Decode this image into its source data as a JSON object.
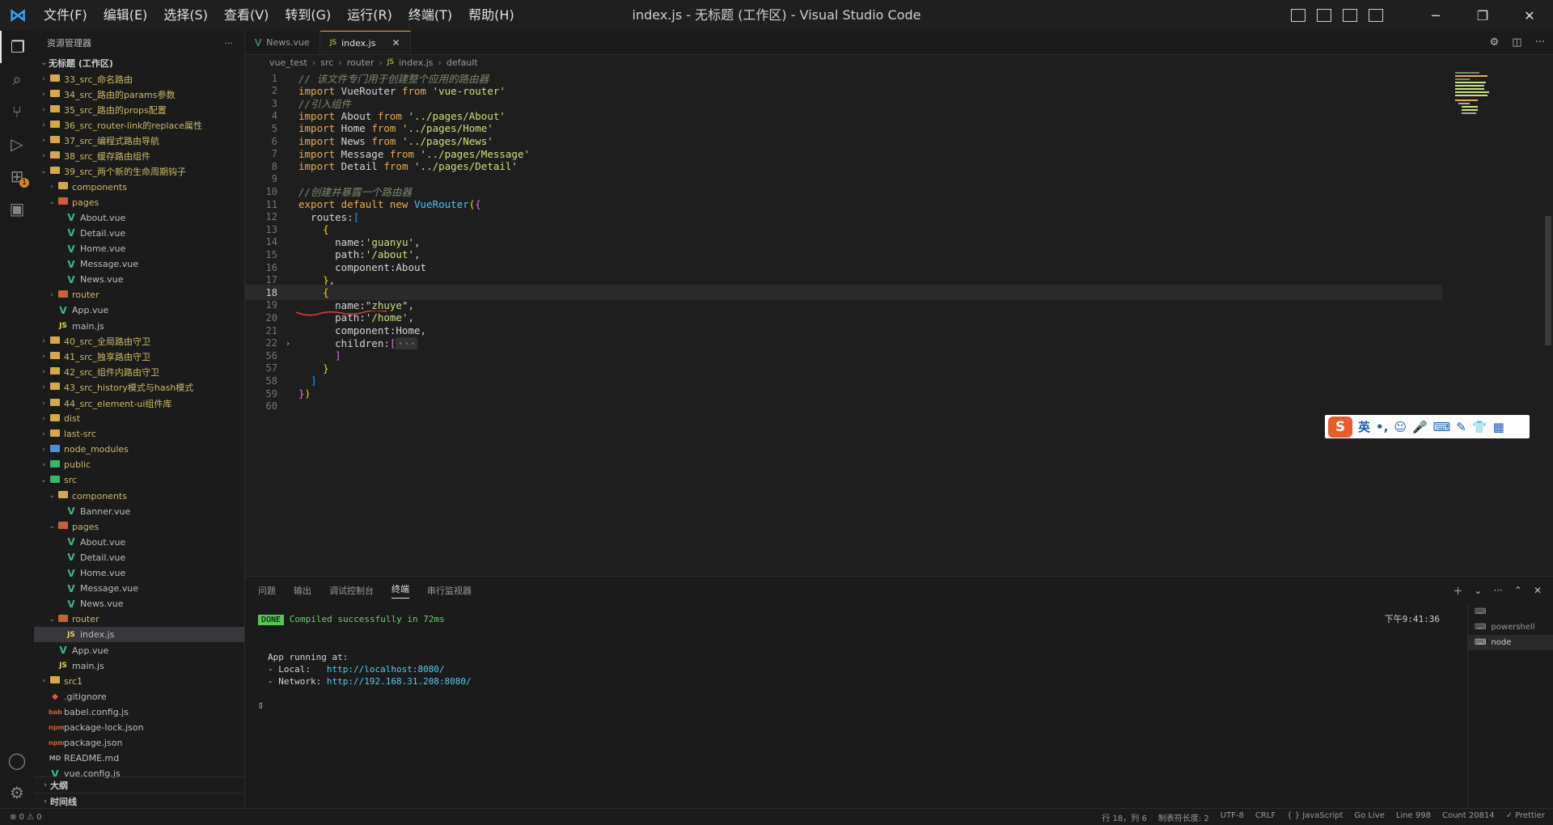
{
  "window": {
    "title": "index.js - 无标题 (工作区) - Visual Studio Code",
    "menu": [
      "文件(F)",
      "编辑(E)",
      "选择(S)",
      "查看(V)",
      "转到(G)",
      "运行(R)",
      "终端(T)",
      "帮助(H)"
    ]
  },
  "sidebar": {
    "header": "资源管理器",
    "more": "···",
    "workspace": "无标题 (工作区)",
    "tree": [
      {
        "label": "33_src_命名路由",
        "type": "folder",
        "depth": 1,
        "open": false,
        "color": "yellow"
      },
      {
        "label": "34_src_路由的params参数",
        "type": "folder",
        "depth": 1,
        "open": false,
        "color": "yellow"
      },
      {
        "label": "35_src_路由的props配置",
        "type": "folder",
        "depth": 1,
        "open": false,
        "color": "yellow"
      },
      {
        "label": "36_src_router-link的replace属性",
        "type": "folder",
        "depth": 1,
        "open": false,
        "color": "yellow"
      },
      {
        "label": "37_src_编程式路由导航",
        "type": "folder",
        "depth": 1,
        "open": false,
        "color": "yellow"
      },
      {
        "label": "38_src_缓存路由组件",
        "type": "folder",
        "depth": 1,
        "open": false,
        "color": "yellow"
      },
      {
        "label": "39_src_两个新的生命周期钩子",
        "type": "folder",
        "depth": 1,
        "open": true,
        "color": "yellow"
      },
      {
        "label": "components",
        "type": "folder",
        "depth": 2,
        "open": false,
        "color": "yellow"
      },
      {
        "label": "pages",
        "type": "folder",
        "depth": 2,
        "open": true,
        "color": "red"
      },
      {
        "label": "About.vue",
        "type": "vue",
        "depth": 3
      },
      {
        "label": "Detail.vue",
        "type": "vue",
        "depth": 3
      },
      {
        "label": "Home.vue",
        "type": "vue",
        "depth": 3
      },
      {
        "label": "Message.vue",
        "type": "vue",
        "depth": 3
      },
      {
        "label": "News.vue",
        "type": "vue",
        "depth": 3
      },
      {
        "label": "router",
        "type": "folder",
        "depth": 2,
        "open": false,
        "color": "red"
      },
      {
        "label": "App.vue",
        "type": "vue",
        "depth": 2
      },
      {
        "label": "main.js",
        "type": "js",
        "depth": 2
      },
      {
        "label": "40_src_全局路由守卫",
        "type": "folder",
        "depth": 1,
        "open": false,
        "color": "yellow"
      },
      {
        "label": "41_src_独享路由守卫",
        "type": "folder",
        "depth": 1,
        "open": false,
        "color": "yellow"
      },
      {
        "label": "42_src_组件内路由守卫",
        "type": "folder",
        "depth": 1,
        "open": false,
        "color": "yellow"
      },
      {
        "label": "43_src_history模式与hash模式",
        "type": "folder",
        "depth": 1,
        "open": false,
        "color": "yellow"
      },
      {
        "label": "44_src_element-ui组件库",
        "type": "folder",
        "depth": 1,
        "open": false,
        "color": "yellow"
      },
      {
        "label": "dist",
        "type": "folder",
        "depth": 1,
        "open": false,
        "color": "yellow"
      },
      {
        "label": "last-src",
        "type": "folder",
        "depth": 1,
        "open": false,
        "color": "yellow"
      },
      {
        "label": "node_modules",
        "type": "folder",
        "depth": 1,
        "open": false,
        "color": "blue"
      },
      {
        "label": "public",
        "type": "folder",
        "depth": 1,
        "open": false,
        "color": "green"
      },
      {
        "label": "src",
        "type": "folder",
        "depth": 1,
        "open": true,
        "color": "green"
      },
      {
        "label": "components",
        "type": "folder",
        "depth": 2,
        "open": true,
        "color": "yellow"
      },
      {
        "label": "Banner.vue",
        "type": "vue",
        "depth": 3
      },
      {
        "label": "pages",
        "type": "folder",
        "depth": 2,
        "open": true,
        "color": "red"
      },
      {
        "label": "About.vue",
        "type": "vue",
        "depth": 3
      },
      {
        "label": "Detail.vue",
        "type": "vue",
        "depth": 3
      },
      {
        "label": "Home.vue",
        "type": "vue",
        "depth": 3
      },
      {
        "label": "Message.vue",
        "type": "vue",
        "depth": 3
      },
      {
        "label": "News.vue",
        "type": "vue",
        "depth": 3
      },
      {
        "label": "router",
        "type": "folder",
        "depth": 2,
        "open": true,
        "color": "red"
      },
      {
        "label": "index.js",
        "type": "js",
        "depth": 3,
        "active": true
      },
      {
        "label": "App.vue",
        "type": "vue",
        "depth": 2
      },
      {
        "label": "main.js",
        "type": "js",
        "depth": 2
      },
      {
        "label": "src1",
        "type": "folder",
        "depth": 1,
        "open": false,
        "color": "yellow"
      },
      {
        "label": ".gitignore",
        "type": "git",
        "depth": 1
      },
      {
        "label": "babel.config.js",
        "type": "babel",
        "depth": 1
      },
      {
        "label": "package-lock.json",
        "type": "json",
        "depth": 1
      },
      {
        "label": "package.json",
        "type": "json",
        "depth": 1
      },
      {
        "label": "README.md",
        "type": "md",
        "depth": 1
      },
      {
        "label": "vue.config.js",
        "type": "vue",
        "depth": 1
      }
    ],
    "outline": "大纲",
    "timeline": "时间线"
  },
  "tabs": [
    {
      "label": "News.vue",
      "icon": "vue",
      "active": false
    },
    {
      "label": "index.js",
      "icon": "js",
      "active": true
    }
  ],
  "breadcrumbs": [
    "vue_test",
    "src",
    "router",
    "index.js",
    "default"
  ],
  "editor": {
    "lines": [
      {
        "n": "1",
        "html": "<span class='c-cm'>// 该文件专门用于创建整个应用的路由器</span>"
      },
      {
        "n": "2",
        "html": "<span class='c-kw'>import</span> VueRouter <span class='c-kw'>from</span> <span class='c-str'>'vue-router'</span>"
      },
      {
        "n": "3",
        "html": "<span class='c-cm'>//引入组件</span>"
      },
      {
        "n": "4",
        "html": "<span class='c-kw'>import</span> About <span class='c-kw'>from</span> <span class='c-str'>'../pages/About'</span>"
      },
      {
        "n": "5",
        "html": "<span class='c-kw'>import</span> Home <span class='c-kw'>from</span> <span class='c-str'>'../pages/Home'</span>"
      },
      {
        "n": "6",
        "html": "<span class='c-kw'>import</span> News <span class='c-kw'>from</span> <span class='c-str'>'../pages/News'</span>"
      },
      {
        "n": "7",
        "html": "<span class='c-kw'>import</span> Message <span class='c-kw'>from</span> <span class='c-str'>'../pages/Message'</span>"
      },
      {
        "n": "8",
        "html": "<span class='c-kw'>import</span> Detail <span class='c-kw'>from</span> <span class='c-str'>'../pages/Detail'</span>"
      },
      {
        "n": "9",
        "html": ""
      },
      {
        "n": "10",
        "html": "<span class='c-cm'>//创建并暴露一个路由器</span>"
      },
      {
        "n": "11",
        "html": "<span class='c-kw'>export default new</span> <span class='c-cls'>VueRouter</span><span class='c-br1'>(</span><span class='c-br2'>{</span>"
      },
      {
        "n": "12",
        "html": "  routes:<span class='c-br3'>[</span>"
      },
      {
        "n": "13",
        "html": "    <span class='c-br1'>{</span>"
      },
      {
        "n": "14",
        "html": "      name:<span class='c-str'>'guanyu'</span>,"
      },
      {
        "n": "15",
        "html": "      path:<span class='c-str'>'/about'</span>,"
      },
      {
        "n": "16",
        "html": "      component:About"
      },
      {
        "n": "17",
        "html": "    <span class='c-br1'>}</span>,"
      },
      {
        "n": "18",
        "html": "    <span class='c-br1'>{</span>",
        "current": true
      },
      {
        "n": "19",
        "html": "      name:<span class='c-str'>\"zhuye\"</span>,"
      },
      {
        "n": "20",
        "html": "      path:<span class='c-str'>'/home'</span>,"
      },
      {
        "n": "21",
        "html": "      component:Home,"
      },
      {
        "n": "22",
        "html": "      children:<span class='c-br2'>[</span><span class='c-fold'>···</span>",
        "folded": true
      },
      {
        "n": "56",
        "html": "      <span class='c-br2'>]</span>"
      },
      {
        "n": "57",
        "html": "    <span class='c-br1'>}</span>"
      },
      {
        "n": "58",
        "html": "  <span class='c-br3'>]</span>"
      },
      {
        "n": "59",
        "html": "<span class='c-br2'>}</span><span class='c-br1'>)</span>"
      },
      {
        "n": "60",
        "html": ""
      }
    ]
  },
  "ime": {
    "mode": "英",
    "punct": "•,"
  },
  "panel": {
    "tabs": [
      "问题",
      "输出",
      "调试控制台",
      "终端",
      "串行监视器"
    ],
    "active_tab": "终端",
    "done_badge": "DONE",
    "compiled": "Compiled successfully in 72ms",
    "time": "下午9:41:36",
    "running": "App running at:",
    "local_label": "- Local:   ",
    "local_url": "http://localhost:8080/",
    "network_label": "- Network: ",
    "network_url": "http://192.168.31.208:8080/",
    "terminals": [
      "powershell",
      "node"
    ]
  },
  "status": {
    "problems": "⊗ 0 ⚠ 0",
    "items": [
      "行 18，列 6",
      "制表符长度: 2",
      "UTF-8",
      "CRLF",
      "{ } JavaScript",
      "Go Live",
      "Line 998",
      "Count 20814",
      "✓ Prettier"
    ]
  }
}
